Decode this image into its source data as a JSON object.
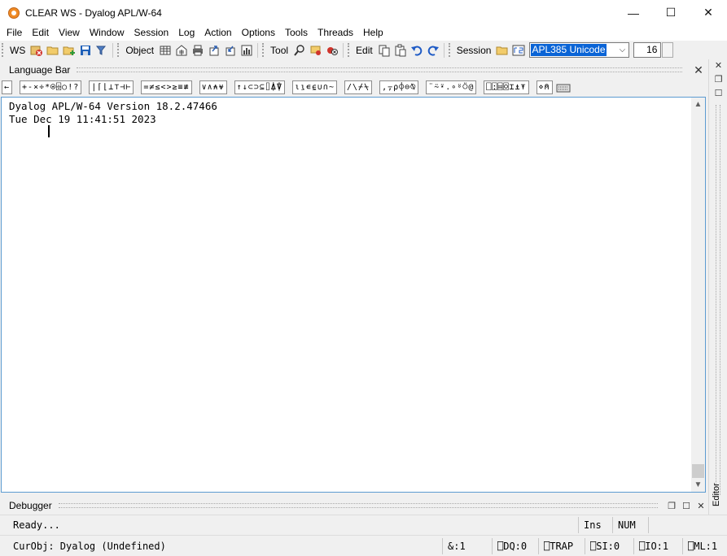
{
  "window": {
    "title": "CLEAR WS - Dyalog APL/W-64",
    "minimize": "—",
    "maximize": "☐",
    "close": "✕"
  },
  "menu": [
    "File",
    "Edit",
    "View",
    "Window",
    "Session",
    "Log",
    "Action",
    "Options",
    "Tools",
    "Threads",
    "Help"
  ],
  "toolbar": {
    "ws_label": "WS",
    "object_label": "Object",
    "tool_label": "Tool",
    "edit_label": "Edit",
    "session_label": "Session",
    "font_name": "APL385 Unicode",
    "font_size": "16"
  },
  "language_bar": {
    "title": "Language Bar",
    "groups": [
      "←",
      "+-×÷*⍟⌹○!?",
      "|⌈⌊⊥⊤⊣⊢",
      "=≠≤<>≥≡≢",
      "∨∧⍲⍱",
      "↑↓⊂⊃⊆⌷⍋⍒",
      "⍳⍸∊⍷∪∩~",
      "/\\⌿⍀",
      ",⍪⍴⌽⊖⍉",
      "¨⍨⍣.∘⍤⍥@",
      "⎕⍠⌸⌺⌶⍎⍕",
      "⋄⍝"
    ]
  },
  "session": {
    "lines": [
      "Dyalog APL/W-64 Version 18.2.47466",
      "Tue Dec 19 11:41:51 2023"
    ]
  },
  "right_dock": {
    "editor_label": "Editor"
  },
  "debugger": {
    "title": "Debugger"
  },
  "status_bar": {
    "message": "Ready...",
    "ins": "Ins",
    "num": "NUM",
    "curobj": "CurObj: Dyalog (Undefined)",
    "amp": "&:1",
    "dq": "⎕DQ:0",
    "trap": "⎕TRAP",
    "si": "⎕SI:0",
    "io": "⎕IO:1",
    "ml": "⎕ML:1"
  },
  "colors": {
    "selection": "#0a64d6",
    "session_border": "#5c9bd1",
    "app_icon": "#f08a24"
  }
}
